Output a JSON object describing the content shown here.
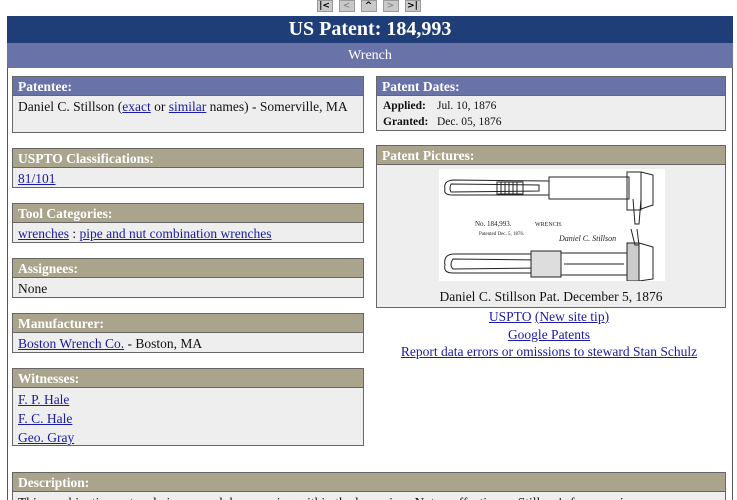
{
  "nav": {
    "first": "|<",
    "prev": "<",
    "up": "^",
    "next": ">",
    "last": ">|"
  },
  "header": {
    "title": "US Patent: 184,993",
    "subtitle": "Wrench"
  },
  "patentee": {
    "heading": "Patentee:",
    "name": "Daniel C. Stillson",
    "open_paren": "(",
    "exact": "exact",
    "or": "or",
    "similar": "similar",
    "names_suffix": "names) - Somerville, MA"
  },
  "dates": {
    "heading": "Patent Dates:",
    "applied_label": "Applied:",
    "applied": "Jul. 10, 1876",
    "granted_label": "Granted:",
    "granted": "Dec. 05, 1876"
  },
  "uspto": {
    "heading": "USPTO Classifications:",
    "class": "81/101"
  },
  "pictures": {
    "heading": "Patent Pictures:",
    "drawing_no": "No. 184,993.",
    "drawing_title": "WRENCH.",
    "drawing_date": "Patented Dec. 5, 1876.",
    "drawing_signature": "Daniel C. Stillson",
    "caption": "Daniel C. Stillson Pat. December 5, 1876"
  },
  "tool_categories": {
    "heading": "Tool Categories:",
    "cat1": "wrenches",
    "sep": ":",
    "cat2": "pipe and nut combination wrenches"
  },
  "assignees": {
    "heading": "Assignees:",
    "value": "None"
  },
  "manufacturer": {
    "heading": "Manufacturer:",
    "name": "Boston Wrench Co.",
    "location": "- Boston, MA"
  },
  "witnesses": {
    "heading": "Witnesses:",
    "w1": "F. P. Hale",
    "w2": "F. C. Hale",
    "w3": "Geo. Gray"
  },
  "links": {
    "uspto": "USPTO",
    "new_tip": "(New site tip)",
    "google": "Google Patents",
    "report": "Report data errors or omissions to steward Stan Schulz"
  },
  "description": {
    "heading": "Description:",
    "text": "This combination nut and pipe wrench has a spring within the lower jaw. Not as effective as Stillson's famous pipe"
  },
  "colors": {
    "title_bar": "#1f3e78",
    "sub_bar": "#6a73a8",
    "olive_header": "#a9a48b",
    "link": "#1a1aa6"
  }
}
